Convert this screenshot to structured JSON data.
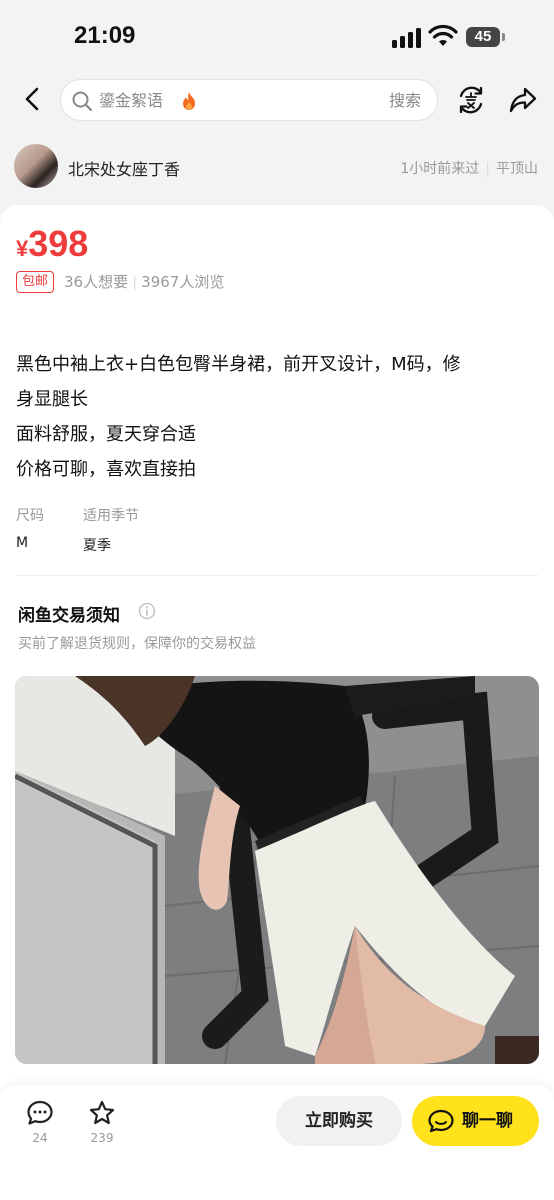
{
  "status_bar": {
    "time": "21:09",
    "battery": "45"
  },
  "nav": {
    "search_placeholder": "鎏金絮语",
    "search_button": "搜索"
  },
  "seller": {
    "name": "北宋处女座丁香",
    "last_seen": "1小时前来过",
    "location": "平顶山"
  },
  "listing": {
    "currency": "¥",
    "price": "398",
    "free_shipping_badge": "包邮",
    "wants": "36人想要",
    "views": "3967人浏览",
    "description_lines": [
      "黑色中袖上衣+白色包臀半身裙，前开叉设计，M码，修",
      "身显腿长",
      "面料舒服，夏天穿合适",
      "价格可聊，喜欢直接拍"
    ],
    "attributes": [
      {
        "label": "尺码",
        "value": "M"
      },
      {
        "label": "适用季节",
        "value": "夏季"
      }
    ]
  },
  "notice": {
    "title": "闲鱼交易须知",
    "subtitle": "买前了解退货规则，保障你的交易权益"
  },
  "bottom_bar": {
    "comments_count": "24",
    "favorites_count": "239",
    "buy_label": "立即购买",
    "chat_label": "聊一聊"
  },
  "colors": {
    "price_red": "#ef3b3b",
    "brand_yellow": "#ffe21c"
  },
  "icons": [
    "back-icon",
    "search-icon",
    "fire-icon",
    "sell-icon",
    "share-icon",
    "info-icon",
    "comment-icon",
    "star-icon",
    "chat-icon"
  ]
}
